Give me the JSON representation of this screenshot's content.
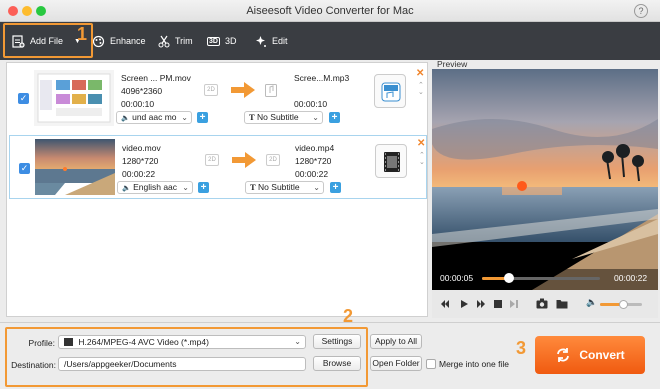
{
  "window": {
    "title": "Aiseesoft Video Converter for Mac",
    "help": "?"
  },
  "toolbar": {
    "add_file": "Add File",
    "enhance": "Enhance",
    "trim": "Trim",
    "three_d": "3D",
    "three_d_badge": "3D",
    "edit": "Edit"
  },
  "callouts": [
    "1",
    "2",
    "3"
  ],
  "files": [
    {
      "src_name": "Screen ... PM.mov",
      "src_res": "4096*2360",
      "src_dur": "00:00:10",
      "dst_name": "Scree...M.mp3",
      "dst_dur": "00:00:10",
      "audio": "und aac mo",
      "subtitle": "No Subtitle",
      "twoD": "2D"
    },
    {
      "src_name": "video.mov",
      "src_res": "1280*720",
      "src_dur": "00:00:22",
      "dst_name": "video.mp4",
      "dst_res": "1280*720",
      "dst_dur": "00:00:22",
      "audio": "English aac",
      "subtitle": "No Subtitle",
      "twoD": "2D"
    }
  ],
  "preview": {
    "label": "Preview",
    "time_current": "00:00:05",
    "time_total": "00:00:22",
    "progress": 0.23,
    "volume": 0.55
  },
  "output": {
    "profile_label": "Profile:",
    "profile_value": "H.264/MPEG-4 AVC Video (*.mp4)",
    "destination_label": "Destination:",
    "destination_value": "/Users/appgeeker/Documents",
    "settings": "Settings",
    "browse": "Browse",
    "apply_all": "Apply to All",
    "open_folder": "Open Folder",
    "merge": "Merge into one file",
    "convert": "Convert"
  },
  "colors": {
    "accent": "#f29935",
    "convert": "#f36c1e",
    "toolbar": "#3a3d42",
    "check": "#3d8de3"
  }
}
